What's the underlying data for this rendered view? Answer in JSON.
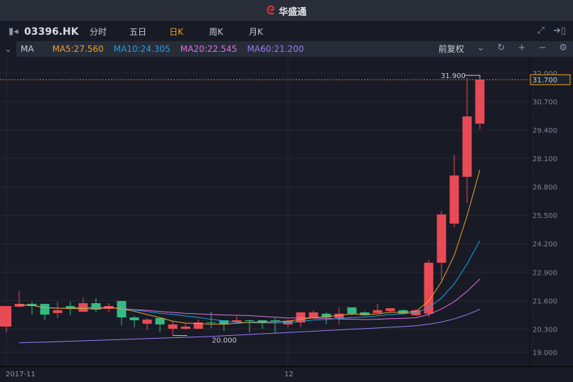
{
  "title": {
    "logo": "华盛通 logo",
    "text": "华盛通"
  },
  "toolbar": {
    "code": "03396.HK",
    "tabs": [
      "分时",
      "五日",
      "日K",
      "周K",
      "月K"
    ],
    "active": 2
  },
  "ma": {
    "label": "MA",
    "ma5": "MA5:27.560",
    "ma10": "MA10:24.305",
    "ma20": "MA20:22.545",
    "ma60": "MA60:21.200",
    "adjust": "前复权"
  },
  "colors": {
    "up": "#e84b55",
    "down": "#33bb84",
    "ma5": "#f0a030",
    "ma10": "#20a0e8",
    "ma20": "#e070e0",
    "ma60": "#9a7cf8",
    "accent": "#f0a020"
  },
  "chart_data": {
    "type": "candlestick",
    "price_labels": [
      "32.000",
      "30.700",
      "29.400",
      "28.100",
      "26.800",
      "25.500",
      "24.200",
      "22.900",
      "21.600",
      "20.300",
      "19.000"
    ],
    "price_values": [
      32,
      30.7,
      29.4,
      28.1,
      26.8,
      25.5,
      24.2,
      22.9,
      21.6,
      20.3,
      19.0
    ],
    "x_labels": [
      {
        "label": "2017-11",
        "index": 0
      },
      {
        "label": "12",
        "index": 22
      }
    ],
    "current_price": "31.700",
    "high_marker": "31.900",
    "low_marker": "20.000",
    "candles": [
      [
        20.41,
        21.35,
        21.35,
        20.15
      ],
      [
        21.32,
        21.45,
        22.03,
        21.29
      ],
      [
        21.45,
        21.35,
        21.55,
        20.96
      ],
      [
        21.45,
        20.96,
        21.45,
        20.7
      ],
      [
        21.03,
        21.16,
        21.55,
        20.8
      ],
      [
        21.35,
        21.25,
        21.55,
        20.93
      ],
      [
        21.09,
        21.48,
        21.74,
        21.06
      ],
      [
        21.48,
        21.19,
        21.71,
        21.06
      ],
      [
        21.22,
        21.35,
        21.48,
        21.06
      ],
      [
        21.58,
        20.83,
        21.58,
        20.47
      ],
      [
        20.83,
        20.7,
        20.9,
        20.38
      ],
      [
        20.54,
        20.73,
        20.8,
        20.25
      ],
      [
        20.8,
        20.51,
        20.8,
        20.15
      ],
      [
        20.31,
        20.51,
        20.67,
        20.0
      ],
      [
        20.31,
        20.41,
        20.55,
        20.28
      ],
      [
        20.31,
        20.6,
        20.73,
        20.28
      ],
      [
        20.6,
        20.57,
        21.09,
        20.34
      ],
      [
        20.7,
        20.51,
        20.7,
        20.21
      ],
      [
        20.6,
        20.7,
        20.9,
        20.55
      ],
      [
        20.7,
        20.67,
        20.73,
        20.15
      ],
      [
        20.7,
        20.6,
        20.7,
        20.31
      ],
      [
        20.7,
        20.68,
        20.8,
        20.12
      ],
      [
        20.51,
        20.67,
        20.73,
        20.38
      ],
      [
        20.6,
        21.06,
        21.09,
        20.38
      ],
      [
        20.8,
        21.06,
        21.16,
        20.8
      ],
      [
        21.0,
        20.83,
        21.06,
        20.51
      ],
      [
        20.8,
        21.0,
        21.29,
        20.51
      ],
      [
        21.29,
        21.0,
        21.29,
        20.93
      ],
      [
        21.06,
        20.93,
        21.12,
        20.9
      ],
      [
        21.03,
        21.16,
        21.45,
        21.03
      ],
      [
        21.12,
        21.25,
        21.25,
        21.06
      ],
      [
        21.16,
        21.0,
        21.2,
        20.97
      ],
      [
        20.93,
        21.16,
        21.2,
        20.9
      ],
      [
        21.0,
        23.33,
        23.46,
        20.85
      ],
      [
        23.33,
        25.54,
        25.7,
        22.52
      ],
      [
        25.12,
        27.32,
        28.27,
        24.95
      ],
      [
        27.26,
        30.02,
        31.77,
        26.06
      ],
      [
        29.69,
        31.7,
        31.9,
        29.43
      ]
    ],
    "ma60": [
      19.66,
      19.67,
      19.69,
      19.7,
      19.72,
      19.74,
      19.76,
      19.78,
      19.8,
      19.82,
      19.84,
      19.86,
      19.88,
      19.9,
      19.92,
      19.94,
      19.96,
      19.99,
      20.02,
      20.05,
      20.08,
      20.11,
      20.14,
      20.17,
      20.2,
      20.23,
      20.26,
      20.29,
      20.32,
      20.35,
      20.38,
      20.41,
      20.45,
      20.52,
      20.62,
      20.76,
      20.96,
      21.2
    ]
  }
}
